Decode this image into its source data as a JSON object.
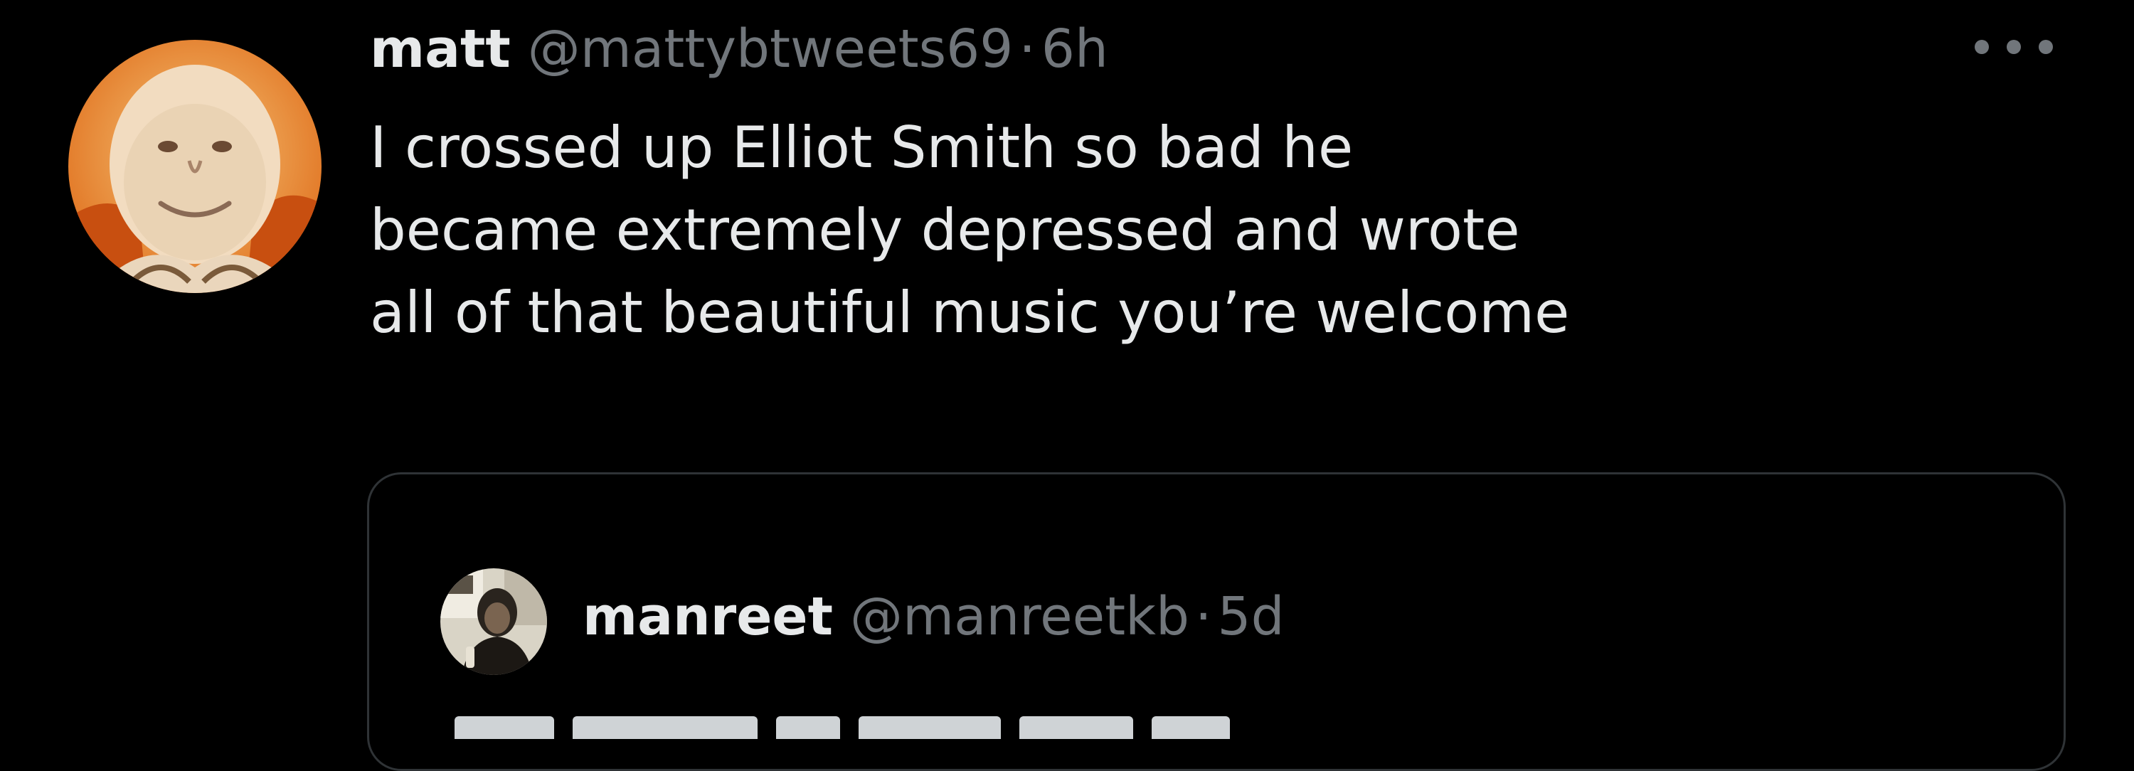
{
  "tweet": {
    "author": {
      "display_name": "matt",
      "handle": "@mattybtweets69",
      "separator": "·",
      "time": "6h",
      "avatar_icon": "profile-photo"
    },
    "more_icon": "more-horizontal-icon",
    "text": "I crossed up Elliot Smith so bad he\nbecame extremely depressed and wrote\nall of that beautiful music you’re welcome"
  },
  "quoted_tweet": {
    "author": {
      "display_name": "manreet",
      "handle": "@manreetkb",
      "separator": "·",
      "time": "5d",
      "avatar_icon": "profile-photo"
    }
  },
  "colors": {
    "background": "#000000",
    "primary_text": "#e7e9ea",
    "secondary_text": "#71767b",
    "border": "#2f3336"
  }
}
